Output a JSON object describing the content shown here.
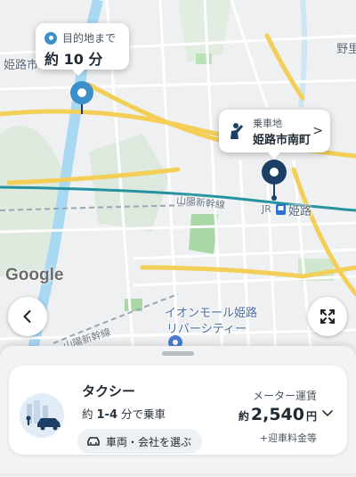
{
  "map": {
    "labels": {
      "city_west": "姫路市",
      "station_east": "野里",
      "shinkansen": "山陽新幹線",
      "station_jr": "JR",
      "station_name": "姫路",
      "mall": "イオンモール姫路",
      "mall2": "リバーシティー",
      "line_sw": "山陽新幹線",
      "district_mid": "姫路"
    },
    "colors": {
      "water": "#9fd3f0",
      "park": "#bfe0c4",
      "road_major": "#f4d66b",
      "road_minor": "#ffffff",
      "rail": "#1f8a9e",
      "accent": "#1c3f66"
    }
  },
  "destination": {
    "label": "目的地まで",
    "time": "約 10 分"
  },
  "pickup": {
    "label": "乗車地",
    "name": "姫路市南町",
    "chevron": ">"
  },
  "attribution": "Google",
  "controls": {
    "back_icon": "chevron-left-icon",
    "expand_icon": "fullscreen-icon"
  },
  "service": {
    "name": "タクシー",
    "eta_prefix": "約",
    "eta_range": "1-4",
    "eta_suffix": "分で乗車",
    "choose_label": "車両・会社を選ぶ",
    "fare_label": "メーター運賃",
    "fare_prefix": "約",
    "fare_amount": "2,540",
    "fare_unit": "円",
    "fare_note": "+迎車料金等"
  }
}
